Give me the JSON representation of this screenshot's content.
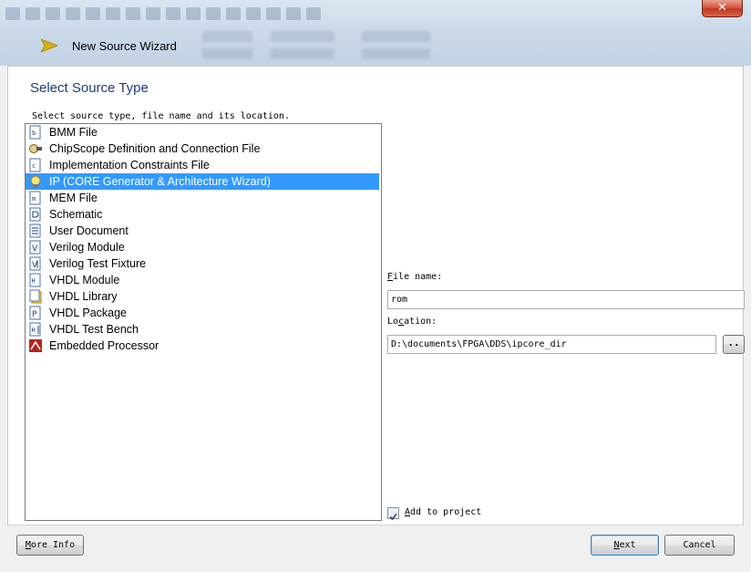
{
  "window": {
    "title": "New Source Wizard",
    "close_glyph": "✕"
  },
  "page": {
    "title": "Select Source Type",
    "instruction": "Select source type, file name and its location."
  },
  "source_types": [
    {
      "label": "BMM File",
      "icon": "bmm-file-icon"
    },
    {
      "label": "ChipScope Definition and Connection File",
      "icon": "chipscope-icon"
    },
    {
      "label": "Implementation Constraints File",
      "icon": "constraints-file-icon"
    },
    {
      "label": "IP (CORE Generator & Architecture Wizard)",
      "icon": "ip-core-icon",
      "selected": true
    },
    {
      "label": "MEM File",
      "icon": "mem-file-icon"
    },
    {
      "label": "Schematic",
      "icon": "schematic-icon"
    },
    {
      "label": "User Document",
      "icon": "user-document-icon"
    },
    {
      "label": "Verilog Module",
      "icon": "verilog-module-icon"
    },
    {
      "label": "Verilog Test Fixture",
      "icon": "verilog-test-fixture-icon"
    },
    {
      "label": "VHDL Module",
      "icon": "vhdl-module-icon"
    },
    {
      "label": "VHDL Library",
      "icon": "vhdl-library-icon"
    },
    {
      "label": "VHDL Package",
      "icon": "vhdl-package-icon"
    },
    {
      "label": "VHDL Test Bench",
      "icon": "vhdl-test-bench-icon"
    },
    {
      "label": "Embedded Processor",
      "icon": "embedded-processor-icon"
    }
  ],
  "file_name": {
    "label_key": "F",
    "label_rest": "ile name:",
    "value": "rom"
  },
  "location": {
    "label_pre": "Lo",
    "label_key": "c",
    "label_rest": "ation:",
    "value": "D:\\documents\\FPGA\\DDS\\ipcore_dir",
    "browse_label": ".."
  },
  "add_to_project": {
    "label_key": "A",
    "label_rest": "dd to project",
    "checked": true
  },
  "buttons": {
    "more_info_key": "M",
    "more_info_rest": "ore Info",
    "next_key": "N",
    "next_rest": "ext",
    "cancel": "Cancel"
  },
  "colors": {
    "selection": "#3399ff",
    "title_text": "#1e3d7b",
    "close_red": "#c0391f"
  }
}
